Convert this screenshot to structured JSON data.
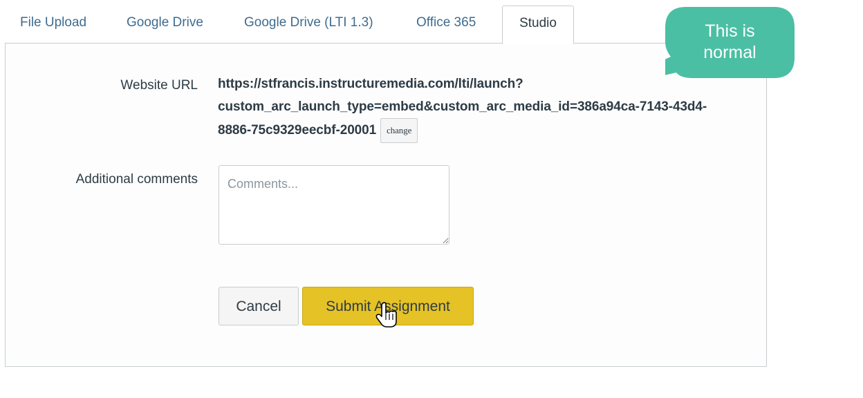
{
  "tabs": [
    {
      "label": "File Upload"
    },
    {
      "label": "Google Drive"
    },
    {
      "label": "Google Drive (LTI 1.3)"
    },
    {
      "label": "Office 365"
    },
    {
      "label": "Studio"
    }
  ],
  "form": {
    "website_url_label": "Website URL",
    "url_line1": "https://stfrancis.instructuremedia.com/lti/launch?",
    "url_line2": "custom_arc_launch_type=embed&custom_arc_media_id=386a94ca-7143-43d4-",
    "url_line3": "8886-75c9329eecbf-20001",
    "change_label": "change",
    "comments_label": "Additional comments",
    "comments_placeholder": "Comments...",
    "comments_value": ""
  },
  "actions": {
    "cancel_label": "Cancel",
    "submit_label": "Submit Assignment"
  },
  "callout": {
    "line1": "This is",
    "line2": "normal",
    "color": "#4bbfa4"
  },
  "colors": {
    "submit_button": "#e5c226",
    "tab_link": "#3f6b8f",
    "text": "#2d3b45"
  },
  "icons": {
    "cursor": "hand-pointer-icon"
  }
}
